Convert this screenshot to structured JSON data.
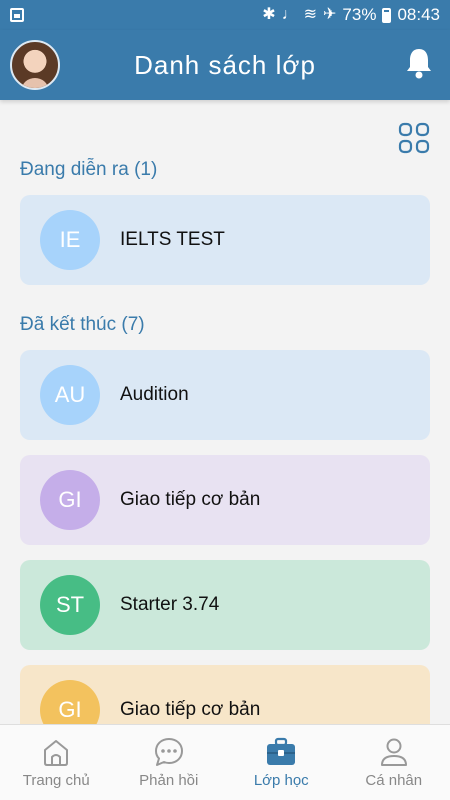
{
  "status_bar": {
    "battery": "73%",
    "time": "08:43",
    "icons": [
      "image-icon",
      "bluetooth-icon",
      "mute-icon",
      "wifi-icon",
      "airplane-icon",
      "battery-icon"
    ]
  },
  "header": {
    "title": "Danh sách lớp",
    "avatar": "avatar",
    "bell": "bell-icon"
  },
  "toolbar": {
    "grid_toggle": "grid-view-icon"
  },
  "sections": {
    "ongoing": {
      "title": "Đang diễn ra (1)",
      "classes": [
        {
          "initials": "IE",
          "name": "IELTS TEST",
          "card_color": "#dbe8f5",
          "badge_color": "#a7d3fb"
        }
      ]
    },
    "finished": {
      "title": "Đã kết thúc (7)",
      "classes": [
        {
          "initials": "AU",
          "name": "Audition",
          "card_color": "#dbe8f5",
          "badge_color": "#a7d3fb"
        },
        {
          "initials": "GI",
          "name": "Giao tiếp cơ bản",
          "card_color": "#e8e2f2",
          "badge_color": "#c5aee9"
        },
        {
          "initials": "ST",
          "name": "Starter 3.74",
          "card_color": "#cbe8da",
          "badge_color": "#47bd85"
        },
        {
          "initials": "GI",
          "name": "Giao tiếp cơ bản",
          "card_color": "#f7e6c9",
          "badge_color": "#f3c25e"
        }
      ]
    }
  },
  "bottom_nav": [
    {
      "label": "Trang chủ",
      "icon": "home-icon",
      "active": false
    },
    {
      "label": "Phản hồi",
      "icon": "chat-icon",
      "active": false
    },
    {
      "label": "Lớp học",
      "icon": "briefcase-icon",
      "active": true
    },
    {
      "label": "Cá nhân",
      "icon": "user-icon",
      "active": false
    }
  ]
}
